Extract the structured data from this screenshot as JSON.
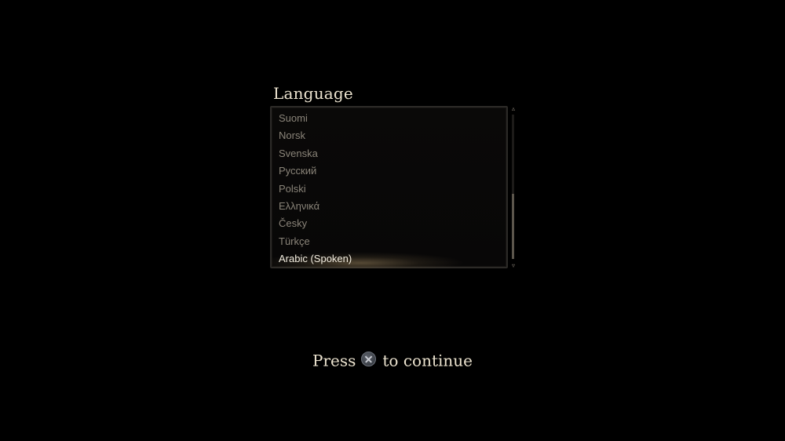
{
  "title": "Language",
  "languages": [
    {
      "label": "Suomi"
    },
    {
      "label": "Norsk"
    },
    {
      "label": "Svenska"
    },
    {
      "label": "Русский"
    },
    {
      "label": "Polski"
    },
    {
      "label": "Ελληνικά"
    },
    {
      "label": "Česky"
    },
    {
      "label": "Türkçe"
    },
    {
      "label": "Arabic (Spoken)"
    }
  ],
  "selected_language": "Arabic (Spoken)",
  "scroll": {
    "position_fraction": 0.55,
    "visible_fraction": 0.45
  },
  "prompt": {
    "before": "Press",
    "button_icon": "cross-button-icon",
    "after": "to continue"
  },
  "colors": {
    "background": "#000000",
    "title_text": "#ece3cf",
    "item_text": "#8a8479",
    "selected_text": "#f3ede0",
    "highlight": "#96805a"
  }
}
